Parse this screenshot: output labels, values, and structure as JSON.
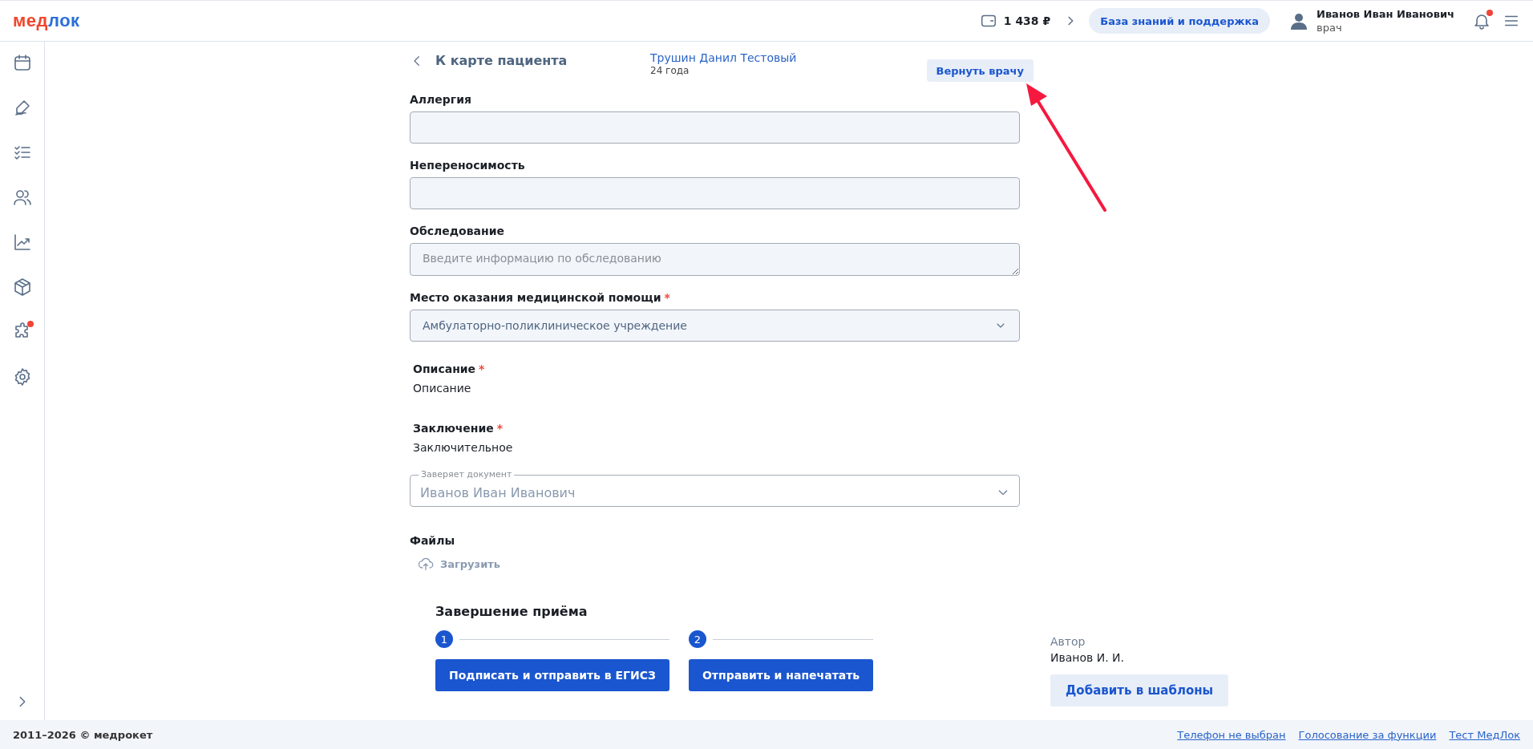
{
  "header": {
    "logo": {
      "first": "мед",
      "second": "лок"
    },
    "balance": "1 438 ₽",
    "help_button": "База знаний и поддержка",
    "user": {
      "name": "Иванов Иван Иванович",
      "role": "врач"
    },
    "notifications": {
      "has_badge": true
    }
  },
  "sidebar": {
    "items": [
      {
        "kind": "calendar",
        "has_badge": false
      },
      {
        "kind": "pen",
        "has_badge": false
      },
      {
        "kind": "checklist",
        "has_badge": false
      },
      {
        "kind": "users",
        "has_badge": false
      },
      {
        "kind": "chart",
        "has_badge": false
      },
      {
        "kind": "box",
        "has_badge": false
      },
      {
        "kind": "puzzle",
        "has_badge": true
      },
      {
        "kind": "gear",
        "has_badge": false
      }
    ]
  },
  "top_bar": {
    "back_link": "К карте пациента",
    "patient_name": "Трушин Данил Тестовый",
    "patient_age": "24 года",
    "return_button": "Вернуть врачу"
  },
  "fields": [
    {
      "kind": "input",
      "label": "Аллергия"
    },
    {
      "kind": "input",
      "label": "Непереносимость"
    },
    {
      "kind": "textarea",
      "label": "Обследование",
      "placeholder": "Введите информацию по обследованию"
    },
    {
      "kind": "select",
      "label": "Место оказания медицинской помощи",
      "required_mark": "*",
      "value": "Амбулаторно-поликлиническое учреждение"
    },
    {
      "kind": "text",
      "label": "Описание",
      "required_mark": "*",
      "value": "Описание"
    },
    {
      "kind": "text",
      "label": "Заключение",
      "required_mark": "*",
      "value": "Заключительное"
    },
    {
      "kind": "outlined-select",
      "label": "Заверяет документ",
      "value": "Иванов Иван Иванович"
    },
    {
      "kind": "upload",
      "label": "Файлы",
      "action": "Загрузить"
    }
  ],
  "finish": {
    "title": "Завершение приёма",
    "steps": [
      {
        "number": "1",
        "button": "Подписать и отправить в ЕГИСЗ"
      },
      {
        "number": "2",
        "button": "Отправить и напечатать"
      }
    ],
    "author_label": "Автор",
    "author": "Иванов И. И.",
    "template_button": "Добавить в шаблоны"
  },
  "footer": {
    "copyright": "2011–2026 © медрокет",
    "links": [
      "Телефон не выбран",
      "Голосование за функции",
      "Тест МедЛок"
    ]
  }
}
